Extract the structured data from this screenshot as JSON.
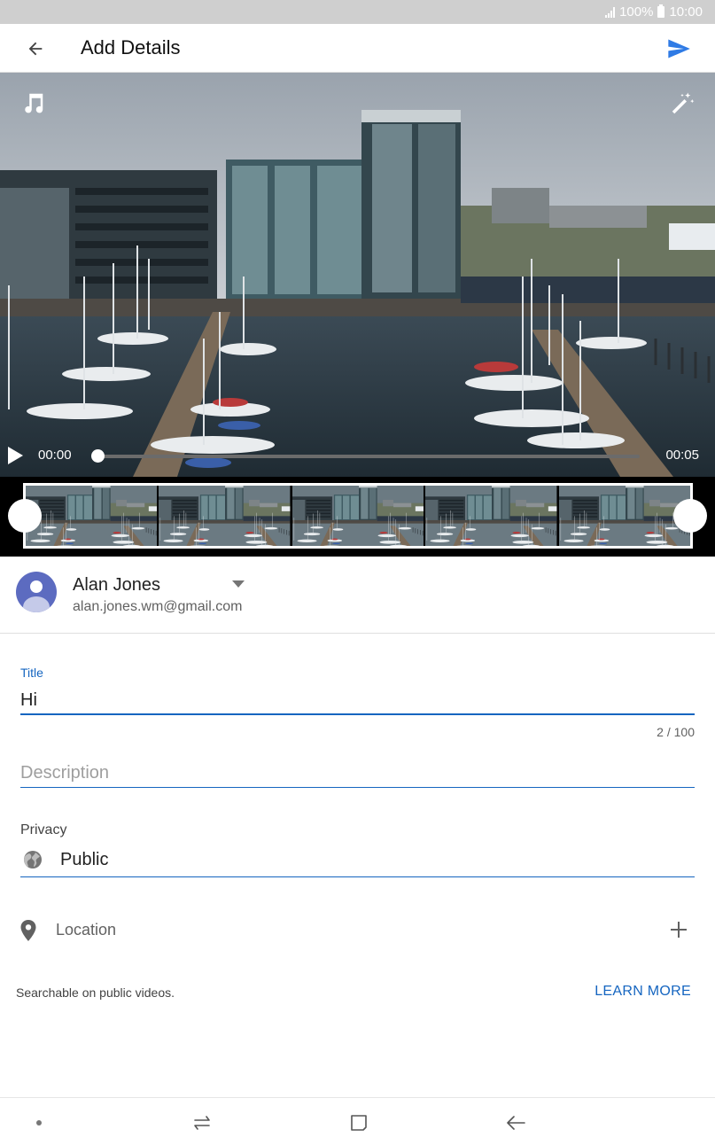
{
  "status_bar": {
    "battery": "100%",
    "time": "10:00"
  },
  "app_bar": {
    "title": "Add Details",
    "back_icon": "arrow-back-icon",
    "send_icon": "send-icon",
    "accent_color": "#2f7be5"
  },
  "video": {
    "music_icon": "music-note-icon",
    "magic_icon": "magic-wand-icon",
    "time_current": "00:00",
    "time_total": "00:05",
    "progress": 0,
    "thumbnail_count": 5
  },
  "account": {
    "name": "Alan Jones",
    "email": "alan.jones.wm@gmail.com"
  },
  "form": {
    "title_label": "Title",
    "title_value": "Hi",
    "char_count": "2 / 100",
    "description_placeholder": "Description",
    "privacy_label": "Privacy",
    "privacy_value": "Public",
    "location_label": "Location",
    "hint": "Searchable on public videos.",
    "learn_more": "LEARN MORE",
    "accent_color": "#1565c0"
  },
  "nav_bar": {
    "icons": [
      "dot-icon",
      "recent-apps-icon",
      "home-icon",
      "back-icon"
    ]
  }
}
